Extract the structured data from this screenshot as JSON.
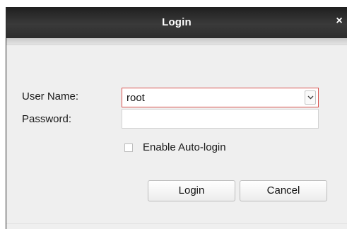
{
  "window": {
    "title": "Login",
    "close_symbol": "×"
  },
  "form": {
    "username_label": "User Name:",
    "username_value": "root",
    "password_label": "Password:",
    "password_value": "",
    "auto_login_label": "Enable Auto-login",
    "auto_login_checked": false
  },
  "buttons": {
    "login_label": "Login",
    "cancel_label": "Cancel"
  },
  "colors": {
    "titlebar": "#2c2c2c",
    "active_border": "#d9534f",
    "dialog_bg": "#efefef"
  },
  "icons": {
    "close": "close-icon",
    "dropdown": "chevron-down-icon"
  }
}
